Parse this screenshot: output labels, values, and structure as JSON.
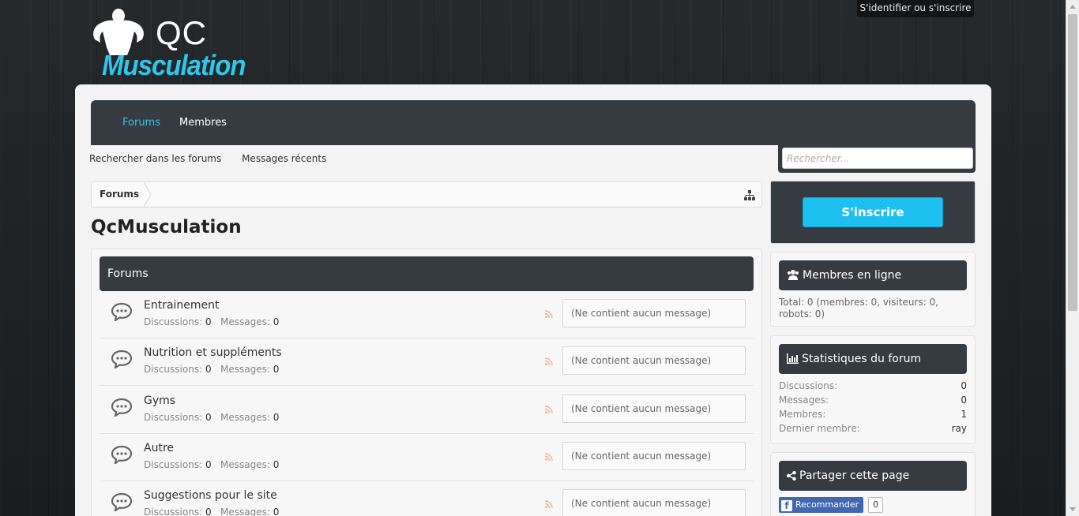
{
  "header": {
    "login_link": "S'identifier ou s'inscrire",
    "logo_top": "QC",
    "logo_word": "Musculation"
  },
  "nav": {
    "tabs": [
      {
        "label": "Forums",
        "active": true
      },
      {
        "label": "Membres",
        "active": false
      }
    ],
    "sub_links": [
      "Rechercher dans les forums",
      "Messages récents"
    ],
    "search_placeholder": "Rechercher..."
  },
  "breadcrumb": {
    "item": "Forums"
  },
  "page_title": "QcMusculation",
  "forums": {
    "header": "Forums",
    "stats_labels": {
      "discussions": "Discussions:",
      "messages": "Messages:"
    },
    "rows": [
      {
        "title": "Entrainement",
        "discussions": "0",
        "messages": "0",
        "last": "(Ne contient aucun message)"
      },
      {
        "title": "Nutrition et suppléments",
        "discussions": "0",
        "messages": "0",
        "last": "(Ne contient aucun message)"
      },
      {
        "title": "Gyms",
        "discussions": "0",
        "messages": "0",
        "last": "(Ne contient aucun message)"
      },
      {
        "title": "Autre",
        "discussions": "0",
        "messages": "0",
        "last": "(Ne contient aucun message)"
      },
      {
        "title": "Suggestions pour le site",
        "discussions": "0",
        "messages": "0",
        "last": "(Ne contient aucun message)"
      }
    ]
  },
  "sidebar": {
    "register_button": "S'inscrire",
    "online": {
      "title": "Membres en ligne",
      "text": "Total: 0 (membres: 0, visiteurs: 0, robots: 0)"
    },
    "stats": {
      "title": "Statistiques du forum",
      "rows": [
        {
          "label": "Discussions:",
          "value": "0"
        },
        {
          "label": "Messages:",
          "value": "0"
        },
        {
          "label": "Membres:",
          "value": "1"
        },
        {
          "label": "Dernier membre:",
          "value": "ray"
        }
      ]
    },
    "share": {
      "title": "Partager cette page",
      "fb_label": "Recommander",
      "fb_count": "0"
    }
  },
  "colors": {
    "accent": "#2fc6ea",
    "dark": "#363b42",
    "button": "#1ec0ef"
  }
}
